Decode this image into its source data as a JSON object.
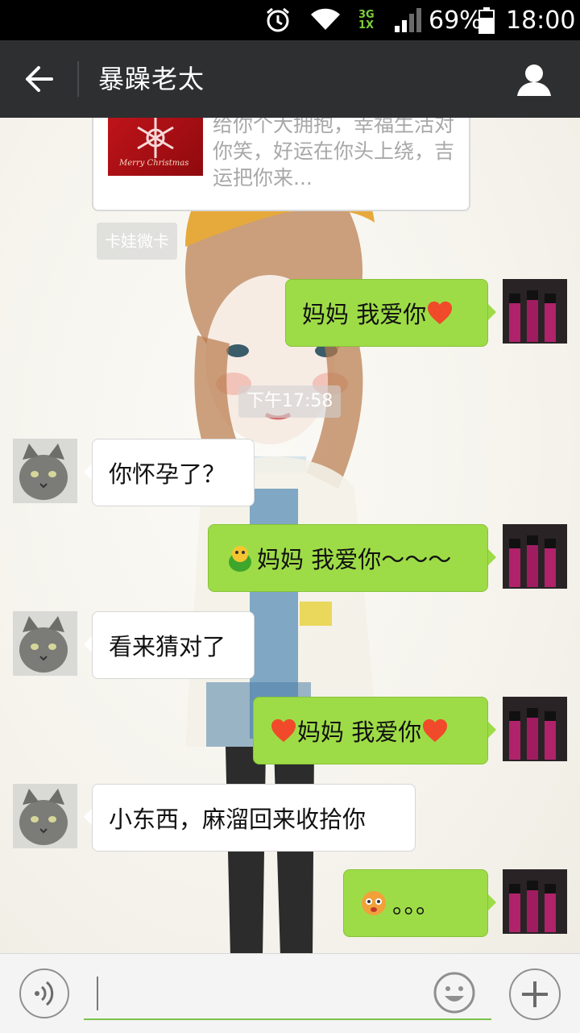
{
  "status_bar": {
    "network_top": "3G",
    "network_bottom": "1X",
    "battery_percent": "69%",
    "time": "18:00"
  },
  "header": {
    "title": "暴躁老太"
  },
  "chat": {
    "card_text": "给你个大拥抱，幸福生活对你笑，好运在你头上绕，吉运把你来...",
    "card_image_caption": "Merry Christmas",
    "card_source": "卡娃微卡",
    "timestamp": "下午17:58",
    "messages": [
      {
        "side": "out",
        "text": "妈妈 我爱你"
      },
      {
        "side": "in",
        "text": "你怀孕了？"
      },
      {
        "side": "out",
        "text": "妈妈 我爱你～～～"
      },
      {
        "side": "in",
        "text": "看来猜对了"
      },
      {
        "side": "out",
        "text": "妈妈 我爱你"
      },
      {
        "side": "in",
        "text": "小东西，麻溜回来收拾你"
      },
      {
        "side": "out",
        "text": "。。。"
      }
    ]
  },
  "icons": {
    "back": "arrow-left-icon",
    "profile": "person-icon",
    "voice": "voice-icon",
    "emoji": "smiley-icon",
    "plus": "plus-icon",
    "heart": "heart-emoji-icon"
  },
  "colors": {
    "status_bar": "#000000",
    "title_bar": "#2e2f31",
    "outgoing_bubble": "#9edc47",
    "incoming_bubble": "#ffffff",
    "input_underline": "#7cc24a"
  }
}
